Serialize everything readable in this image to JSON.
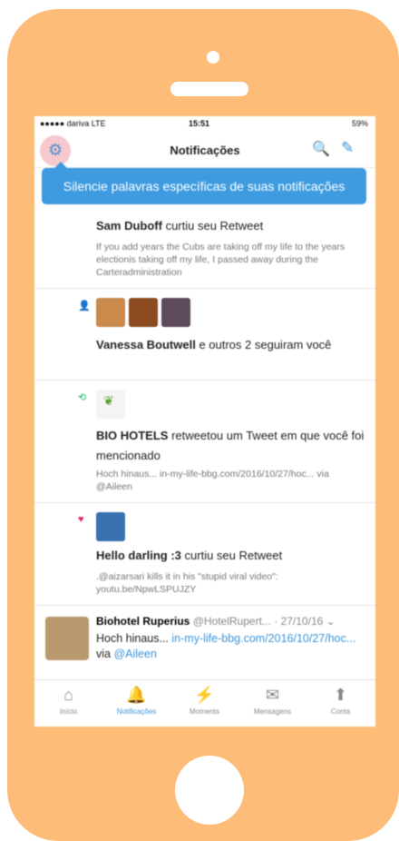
{
  "status": {
    "carrier": "●●●●● dariva LTE",
    "time": "15:51",
    "battery": "59%"
  },
  "nav": {
    "title": "Notificações",
    "gear_icon": "⚙",
    "search_icon": "🔍",
    "compose_icon": "✎"
  },
  "tooltip": "Silencie palavras específicas de suas notificações",
  "notes": [
    {
      "actor": "Sam Duboff",
      "action": " curtiu seu Retweet",
      "quote": "If you add years the Cubs are taking off my life to the years electionis taking off my life, I passed away during the Carteradministration"
    },
    {
      "actor": "Vanessa Boutwell",
      "action": " e outros 2 seguiram você"
    },
    {
      "actor": "BIO HOTELS",
      "action": " retweetou um Tweet em que você foi mencionado",
      "quote": "Hoch hinaus... in-my-life-bbg.com/2016/10/27/hoc... via @Aileen"
    },
    {
      "actor": "Hello darling :3",
      "action": " curtiu seu Retweet",
      "quote": ".@aizarsari kills it in his \"stupid viral video\": youtu.be/NpwLSPUJZY"
    }
  ],
  "tweet": {
    "name": "Biohotel Ruperius",
    "handle": "@HotelRupert...",
    "date": "· 27/10/16",
    "text": "Hoch hinaus...",
    "link": "in-my-life-bbg.com/2016/10/27/hoc...",
    "via": "via",
    "mention": "@Aileen"
  },
  "tabs": [
    {
      "icon": "⌂",
      "label": "Início"
    },
    {
      "icon": "🔔",
      "label": "Notificações"
    },
    {
      "icon": "⚡",
      "label": "Moments"
    },
    {
      "icon": "✉",
      "label": "Mensagens"
    },
    {
      "icon": "⬆",
      "label": "Conta"
    }
  ],
  "colors": {
    "frame": "#fdbd79",
    "accent": "#3b94d9",
    "tooltip": "#3e9be0"
  }
}
